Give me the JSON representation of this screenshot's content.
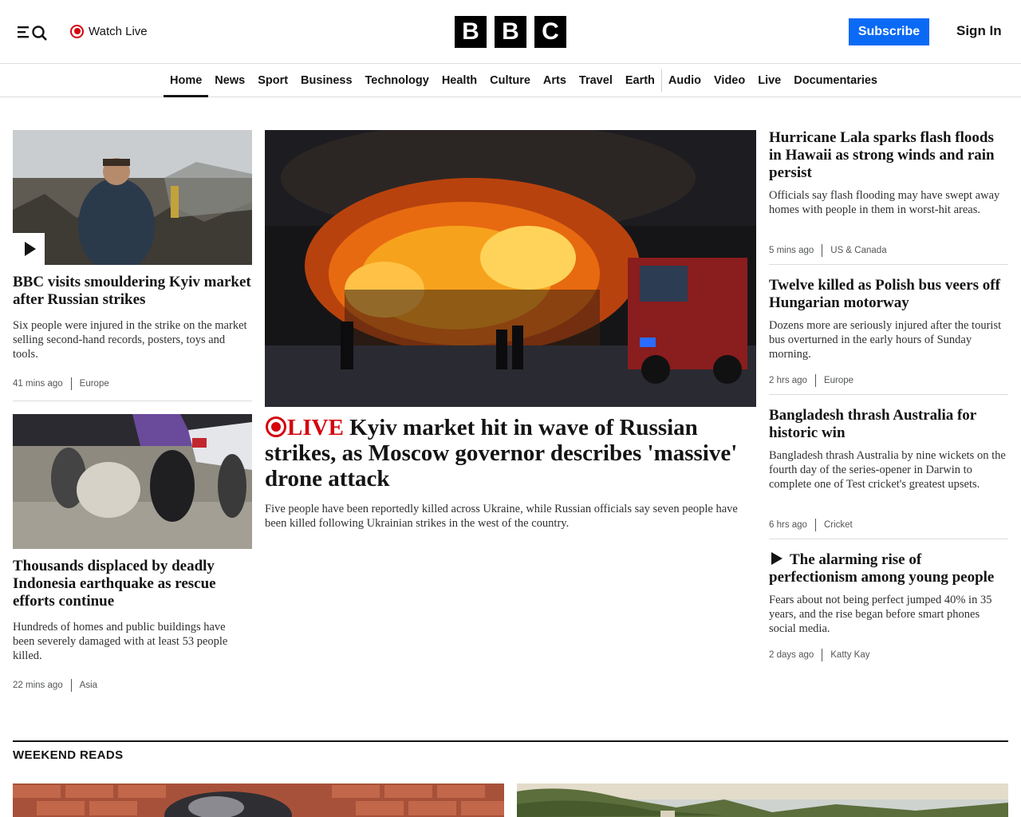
{
  "header": {
    "watch_live_label": "Watch Live",
    "logo_letters": [
      "B",
      "B",
      "C"
    ],
    "subscribe_label": "Subscribe",
    "signin_label": "Sign In"
  },
  "nav": {
    "items": [
      "Home",
      "News",
      "Sport",
      "Business",
      "Technology",
      "Health",
      "Culture",
      "Arts",
      "Travel",
      "Earth",
      "Audio",
      "Video",
      "Live",
      "Documentaries"
    ],
    "active": "Home"
  },
  "left_column": {
    "story1": {
      "headline": "BBC visits smouldering Kyiv market after Russian strikes",
      "summary": "Six people were injured in the strike on the market selling second-hand records, posters, toys and tools.",
      "time": "41 mins ago",
      "category": "Europe"
    },
    "story2": {
      "headline": "Thousands displaced by deadly Indonesia earthquake as rescue efforts continue",
      "summary": "Hundreds of homes and public buildings have been severely damaged with at least 53 people killed.",
      "time": "22 mins ago",
      "category": "Asia"
    }
  },
  "main_story": {
    "live_label": "LIVE",
    "headline": "Kyiv market hit in wave of Russian strikes, as Moscow governor describes 'massive' drone attack",
    "summary": "Five people have been reportedly killed across Ukraine, while Russian officials say seven people have been killed following Ukrainian strikes in the west of the country."
  },
  "right_column": {
    "story1": {
      "headline": "Hurricane Lala sparks flash floods in Hawaii as strong winds and rain persist",
      "summary": "Officials say flash flooding may have swept away homes with people in them in worst-hit areas.",
      "time": "5 mins ago",
      "category": "US & Canada"
    },
    "story2": {
      "headline": "Twelve killed as Polish bus veers off Hungarian motorway",
      "summary": "Dozens more are seriously injured after the tourist bus overturned in the early hours of Sunday morning.",
      "time": "2 hrs ago",
      "category": "Europe"
    },
    "story3": {
      "headline": "Bangladesh thrash Australia for historic win",
      "summary": "Bangladesh thrash Australia by nine wickets on the fourth day of the series-opener in Darwin to complete one of Test cricket's greatest upsets.",
      "time": "6 hrs ago",
      "category": "Cricket"
    },
    "story4": {
      "headline": "The alarming rise of perfectionism among young people",
      "summary": "Fears about not being perfect jumped 40% in 35 years, and the rise began before smart phones social media.",
      "time": "2 days ago",
      "category": "Katty Kay"
    }
  },
  "weekend_reads": {
    "title": "WEEKEND READS"
  },
  "colors": {
    "accent_red": "#d4050f",
    "subscribe_blue": "#0a6af5",
    "text": "#141414"
  },
  "icons": [
    "menu-icon",
    "search-icon",
    "live-icon",
    "play-icon"
  ]
}
